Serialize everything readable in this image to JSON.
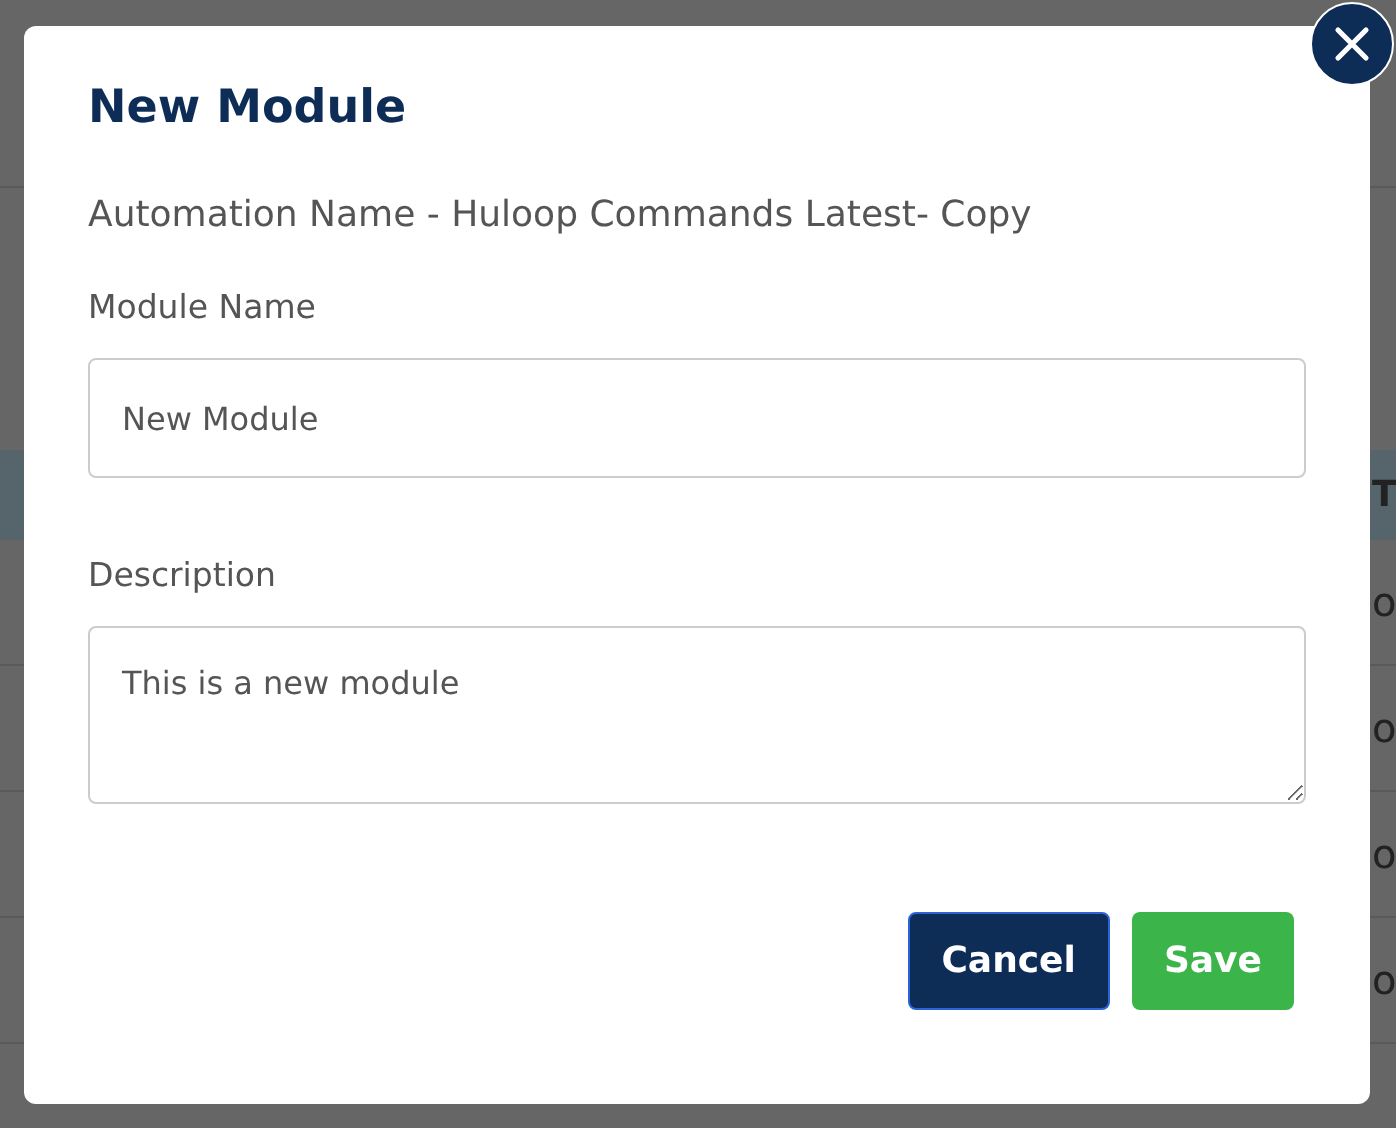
{
  "background": {
    "header_text": "T",
    "rows": [
      "o",
      "o",
      "o",
      "o"
    ]
  },
  "dialog": {
    "title": "New Module",
    "subtitle": "Automation Name - Huloop Commands Latest- Copy",
    "fields": [
      {
        "kind": "input",
        "label": "Module Name",
        "value": "New Module"
      },
      {
        "kind": "textarea",
        "label": "Description",
        "value": "This is a new module"
      }
    ],
    "buttons": [
      {
        "kind": "secondary",
        "label": "Cancel"
      },
      {
        "kind": "primary",
        "label": "Save"
      }
    ]
  }
}
